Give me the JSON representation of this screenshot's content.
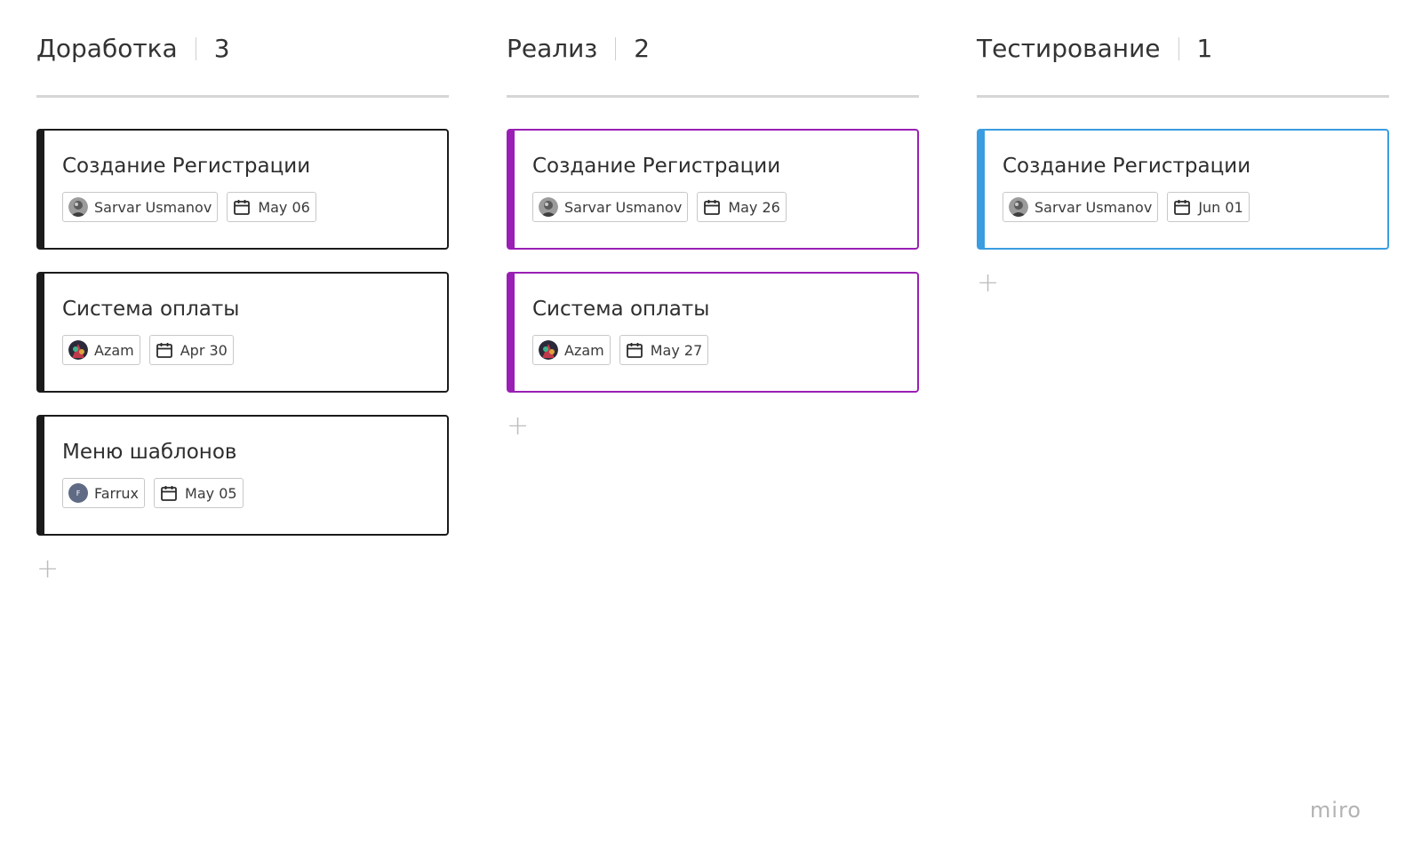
{
  "columns": [
    {
      "title": "Доработка",
      "count": "3",
      "accent": "#1b1b1b",
      "cards": [
        {
          "title": "Создание Регистрации",
          "assignee": "Sarvar Usmanov",
          "avatar": "photo-gray",
          "date": "May 06"
        },
        {
          "title": "Система оплаты",
          "assignee": "Azam",
          "avatar": "photo-color",
          "date": "Apr 30"
        },
        {
          "title": "Меню шаблонов",
          "assignee": "Farrux",
          "avatar": "initial",
          "avatar_initial": "F",
          "date": "May 05"
        }
      ],
      "add_icon": "+"
    },
    {
      "title": "Реализ",
      "count": "2",
      "accent": "#9a1fb5",
      "cards": [
        {
          "title": "Создание Регистрации",
          "assignee": "Sarvar Usmanov",
          "avatar": "photo-gray",
          "date": "May 26"
        },
        {
          "title": "Система оплаты",
          "assignee": "Azam",
          "avatar": "photo-color",
          "date": "May 27"
        }
      ],
      "add_icon": "+"
    },
    {
      "title": "Тестирование",
      "count": "1",
      "accent": "#3a9de0",
      "cards": [
        {
          "title": "Создание Регистрации",
          "assignee": "Sarvar Usmanov",
          "avatar": "photo-gray",
          "date": "Jun 01"
        }
      ],
      "add_icon": "+"
    }
  ],
  "icons": {
    "date": "calendar-icon",
    "add": "plus-icon"
  },
  "branding": {
    "logo": "miro"
  }
}
